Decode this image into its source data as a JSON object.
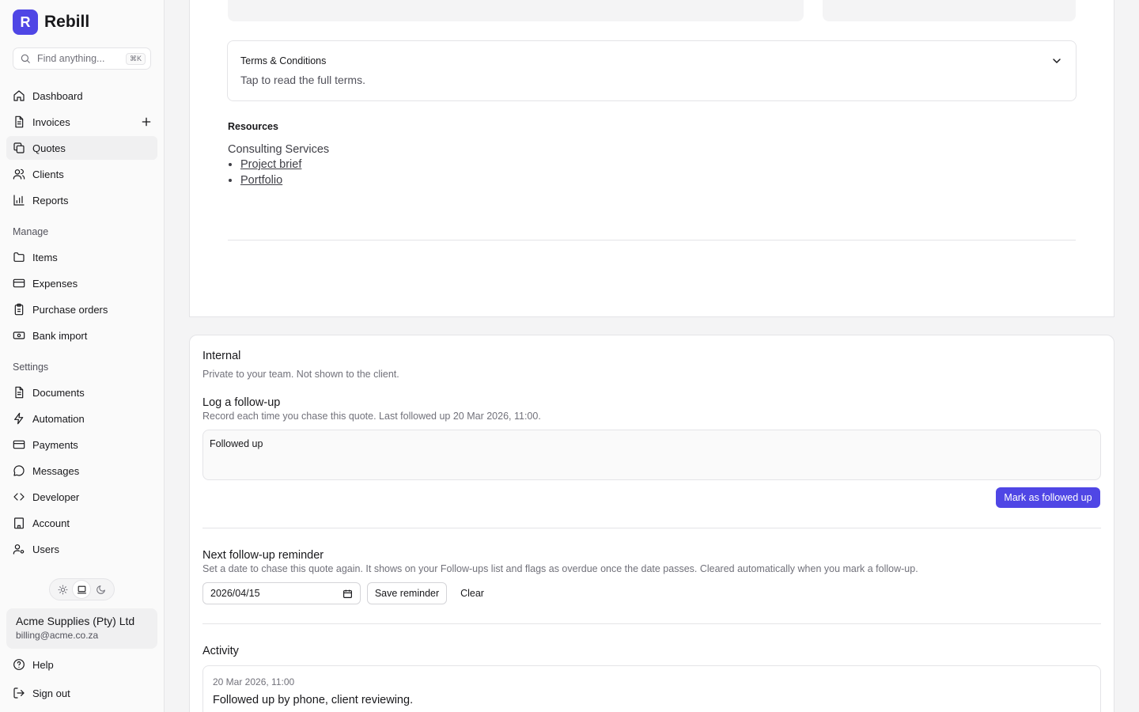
{
  "brand": {
    "logo_letter": "R",
    "name": "Rebill"
  },
  "search": {
    "placeholder": "Find anything...",
    "shortcut": "⌘K"
  },
  "nav": {
    "main": [
      {
        "label": "Dashboard",
        "icon": "home-icon"
      },
      {
        "label": "Invoices",
        "icon": "file-text-icon",
        "has_add": true
      },
      {
        "label": "Quotes",
        "icon": "copy-icon",
        "active": true
      },
      {
        "label": "Clients",
        "icon": "users-icon"
      },
      {
        "label": "Reports",
        "icon": "bar-chart-icon"
      }
    ],
    "manage_label": "Manage",
    "manage": [
      {
        "label": "Items",
        "icon": "folder-icon"
      },
      {
        "label": "Expenses",
        "icon": "credit-card-icon"
      },
      {
        "label": "Purchase orders",
        "icon": "clipboard-icon"
      },
      {
        "label": "Bank import",
        "icon": "banknote-icon"
      }
    ],
    "settings_label": "Settings",
    "settings": [
      {
        "label": "Documents",
        "icon": "file-text-icon"
      },
      {
        "label": "Automation",
        "icon": "zap-icon"
      },
      {
        "label": "Payments",
        "icon": "credit-card-icon"
      },
      {
        "label": "Messages",
        "icon": "message-circle-icon"
      },
      {
        "label": "Developer",
        "icon": "code-icon"
      },
      {
        "label": "Account",
        "icon": "building-icon"
      },
      {
        "label": "Users",
        "icon": "user-cog-icon"
      }
    ],
    "bottom": [
      {
        "label": "Help",
        "icon": "help-circle-icon"
      },
      {
        "label": "Sign out",
        "icon": "log-out-icon"
      }
    ]
  },
  "theme": {
    "options": [
      "light",
      "system",
      "dark"
    ],
    "selected": "system"
  },
  "organization": {
    "name": "Acme Supplies (Pty) Ltd",
    "email": "billing@acme.co.za"
  },
  "terms": {
    "title": "Terms & Conditions",
    "subtitle": "Tap to read the full terms."
  },
  "resources": {
    "title": "Resources",
    "group": "Consulting Services",
    "links": [
      "Project brief",
      "Portfolio"
    ]
  },
  "internal": {
    "title": "Internal",
    "subtitle": "Private to your team. Not shown to the client.",
    "followup": {
      "title": "Log a follow-up",
      "subtitle": "Record each time you chase this quote. Last followed up 20 Mar 2026, 11:00.",
      "note_value": "Followed up",
      "button": "Mark as followed up"
    },
    "reminder": {
      "title": "Next follow-up reminder",
      "subtitle": "Set a date to chase this quote again. It shows on your Follow-ups list and flags as overdue once the date passes. Cleared automatically when you mark a follow-up.",
      "date_value": "2026/04/15",
      "save_button": "Save reminder",
      "clear_button": "Clear"
    },
    "activity": {
      "title": "Activity",
      "entries": [
        {
          "time": "20 Mar 2026, 11:00",
          "text": "Followed up by phone, client reviewing."
        }
      ]
    }
  },
  "colors": {
    "accent": "#4f46e5",
    "border": "#e4e4e7",
    "muted_text": "#71717a"
  }
}
